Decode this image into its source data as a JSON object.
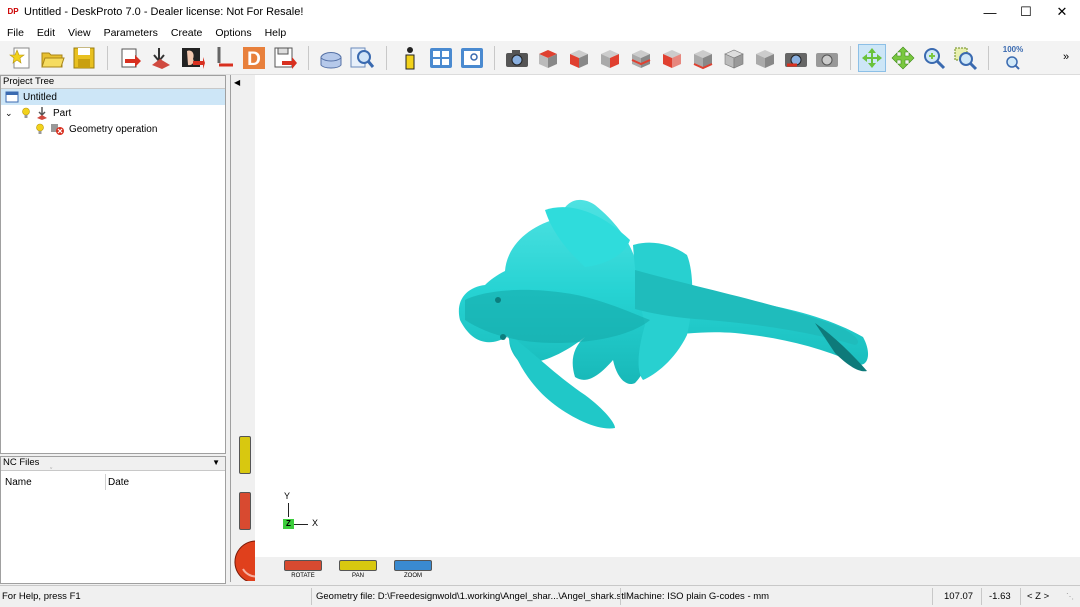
{
  "window": {
    "title": "Untitled - DeskProto 7.0 - Dealer license: Not For Resale!",
    "app_icon": "DP"
  },
  "menu": [
    "File",
    "Edit",
    "View",
    "Parameters",
    "Create",
    "Options",
    "Help"
  ],
  "toolbar": {
    "zoom_level": "100%"
  },
  "project_tree": {
    "header": "Project Tree",
    "root": "Untitled",
    "part": "Part",
    "operation": "Geometry operation"
  },
  "nc_files": {
    "header": "NC Files",
    "columns": [
      "Name",
      "Date"
    ]
  },
  "viewport": {
    "axes": {
      "y": "Y",
      "z": "Z",
      "x": "X"
    },
    "model_color": "#26d3d3"
  },
  "devices": {
    "rotate": "ROTATE",
    "pan": "PAN",
    "zoom": "ZOOM"
  },
  "status": {
    "help": "For Help, press F1",
    "geometry_file": "Geometry file: D:\\Freedesignwold\\1.working\\Angel_shar...\\Angel_shark.stl",
    "machine": "Machine: ISO plain G-codes - mm",
    "x": "107.07",
    "y": "-1.63",
    "axis": "< Z >"
  }
}
